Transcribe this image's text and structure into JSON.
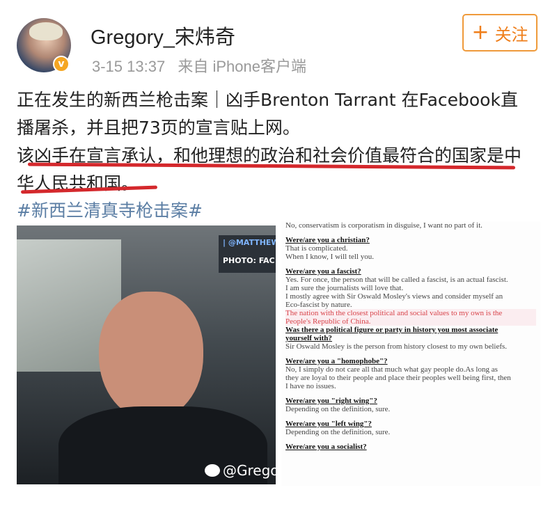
{
  "user": {
    "name": "Gregory_宋炜奇",
    "time": "3-15 13:37",
    "source": "来自 iPhone客户端",
    "follow_label": "关注"
  },
  "post": {
    "line1": "正在发生的新西兰枪击案｜凶手Brenton Tarrant 在Facebook直",
    "line2": "播屠杀，并且把73页的宣言贴上网。",
    "line3": "该凶手在宣言承认，和他理想的政治和社会价值最符合的国家是中",
    "line4": "华人民共和国。",
    "hashtag": "#新西兰清真寺枪击案#"
  },
  "photo": {
    "credit_handle": "| @MATTHEW",
    "credit_label": "PHOTO: FAC",
    "watermark": "@Grego"
  },
  "manifesto": {
    "top_line": "No, conservatism is corporatism in disguise, I want no part of it.",
    "q1": "Were/are you a christian?",
    "a1_1": "That is complicated.",
    "a1_2": "When I know, I will tell you.",
    "q2": "Were/are you a fascist?",
    "a2_1": "Yes. For once, the person that will be called a fascist, is an actual fascist.",
    "a2_2": "I am sure the journalists will love that.",
    "a2_3": "I mostly agree with Sir Oswald Mosley's views and consider myself an",
    "a2_4": "Eco-fascist by nature.",
    "hl_1": "The nation with the closest political and social values to my own is the",
    "hl_2": "People's Republic of China.",
    "q3_1": "Was there a political figure or party in history you most associate",
    "q3_2": "yourself with?",
    "a3": "Sir Oswald Mosley is the person from history closest to my own beliefs.",
    "q4": "Were/are you a \"homophobe\"?",
    "a4_1": "No, I simply do not care all that much what gay people do.As long as",
    "a4_2": "they are loyal to their people and place their peoples well being first, then",
    "a4_3": "I have no issues.",
    "q5": "Were/are you \"right wing\"?",
    "a5": "Depending on the definition, sure.",
    "q6": "Were/are you \"left wing\"?",
    "a6": "Depending on the definition, sure.",
    "q7": "Were/are you a socialist?"
  },
  "colors": {
    "accent": "#ef7e1a",
    "underline": "#d4282c",
    "hashtag": "#5b7ea4",
    "badge": "#f5a623"
  }
}
